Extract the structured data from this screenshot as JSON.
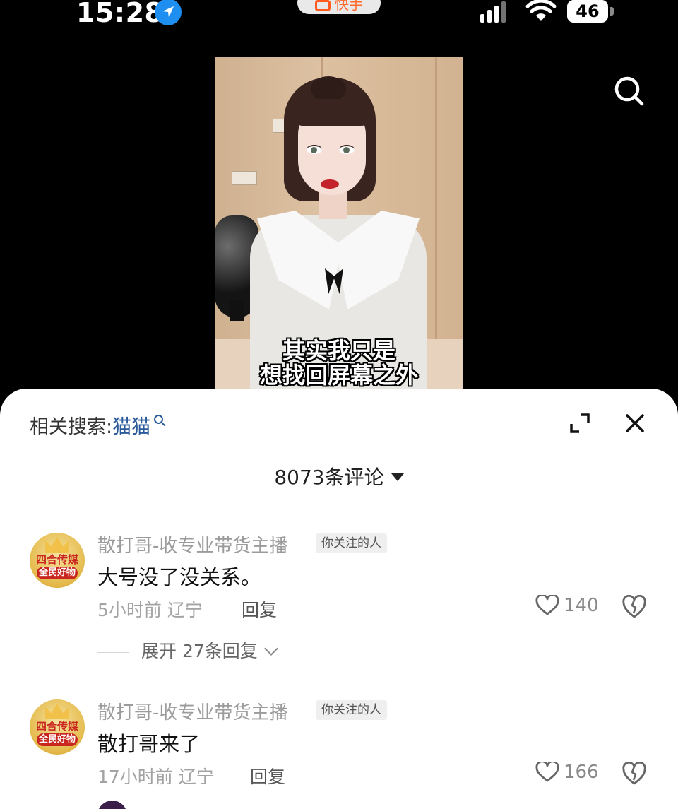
{
  "status_bar": {
    "time": "15:28",
    "app_name": "快手",
    "battery": "46"
  },
  "video": {
    "subtitle_line1": "其实我只是",
    "subtitle_line2": "想找回屏幕之外"
  },
  "comments_panel": {
    "related_search_label": "相关搜索:",
    "related_search_keyword": "猫猫",
    "comment_count": "8073条评论",
    "comments": [
      {
        "username": "散打哥-收专业带货主播",
        "tag": "你关注的人",
        "avatar_text_line1": "四合传媒",
        "avatar_text_line2": "全民好物",
        "text": "大号没了没关系。",
        "time_location": "5小时前 辽宁",
        "reply_label": "回复",
        "likes": "140",
        "expand_replies": "展开 27条回复"
      },
      {
        "username": "散打哥-收专业带货主播",
        "tag": "你关注的人",
        "avatar_text_line1": "四合传媒",
        "avatar_text_line2": "全民好物",
        "text": "散打哥来了",
        "time_location": "17小时前 辽宁",
        "reply_label": "回复",
        "likes": "166"
      }
    ]
  },
  "icons": {
    "location": "location-arrow-icon",
    "signal": "cellular-signal-icon",
    "wifi": "wifi-icon",
    "search": "search-icon",
    "expand": "expand-icon",
    "close": "close-icon",
    "like": "heart-outline-icon",
    "dislike": "broken-heart-icon"
  },
  "colors": {
    "background": "#000000",
    "sheet": "#ffffff",
    "keyword": "#2a5a9a",
    "location_badge": "#1f8ef1"
  }
}
